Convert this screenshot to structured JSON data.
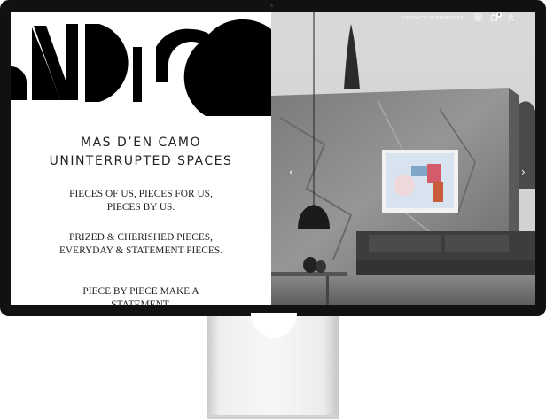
{
  "nav": {
    "contact": "CONTACT US",
    "products": "PRODUCTS",
    "icons": [
      "instagram-icon",
      "bag-icon",
      "user-icon"
    ],
    "cart_count": "0"
  },
  "hero": {
    "title_line1": "MAS D’EN CAMO",
    "title_line2": "UNINTERRUPTED SPACES",
    "para1": "PIECES OF US, PIECES FOR US, PIECES BY US.",
    "para2": "PRIZED & CHERISHED PIECES, EVERYDAY & STATEMENT PIECES.",
    "para3": "PIECE BY PIECE MAKE A STATEMENT."
  },
  "carousel": {
    "prev_icon": "chevron-left-icon",
    "next_icon": "chevron-right-icon"
  },
  "colors": {
    "logo": "#000000",
    "text": "#222222",
    "monitor_bezel": "#111111"
  }
}
